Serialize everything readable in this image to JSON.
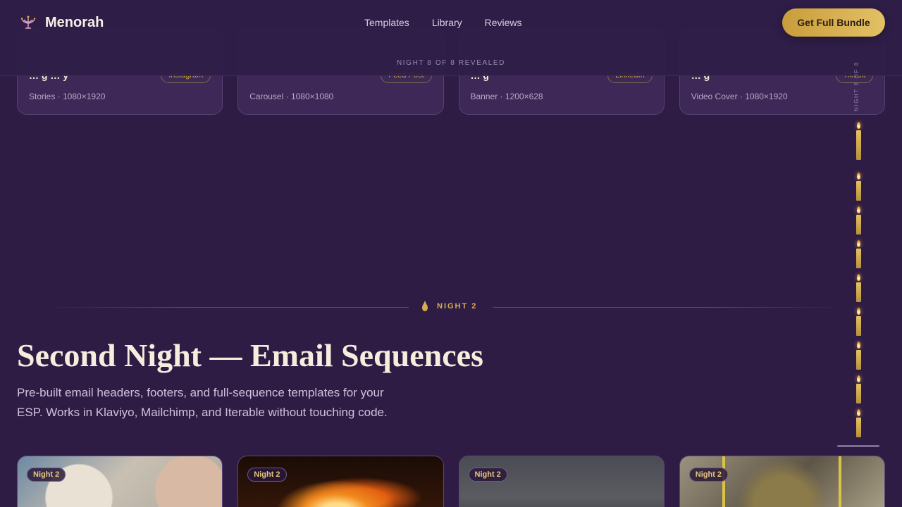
{
  "header": {
    "brand": "Menorah",
    "nav": [
      "Templates",
      "Library",
      "Reviews"
    ],
    "cta": "Get Full Bundle",
    "night_status": "NIGHT 8 OF 8 REVEALED"
  },
  "prev_cards": [
    {
      "title": "… g … y",
      "pill": "Instagram",
      "meta": "Stories · 1080×1920"
    },
    {
      "title": "",
      "pill": "Feed Post",
      "meta": "Carousel · 1080×1080"
    },
    {
      "title": "… g",
      "pill": "LinkedIn",
      "meta": "Banner · 1200×628"
    },
    {
      "title": "… g",
      "pill": "TikTok",
      "meta": "Video Cover · 1080×1920"
    }
  ],
  "rail": {
    "label": "NIGHT 8 OF 8",
    "candles_lit": 8,
    "candles_total": 9
  },
  "section": {
    "tag": "NIGHT 2",
    "title": "Second Night — Email Sequences",
    "description": "Pre-built email headers, footers, and full-sequence templates for your ESP. Works in Klaviyo, Mailchimp, and Iterable without touching code."
  },
  "cards": [
    {
      "badge": "Night 2"
    },
    {
      "badge": "Night 2"
    },
    {
      "badge": "Night 2"
    },
    {
      "badge": "Night 2"
    }
  ],
  "colors": {
    "background": "#2e1c45",
    "accent_gold": "#d7ae4f",
    "cta_gold": "#e3c066"
  }
}
